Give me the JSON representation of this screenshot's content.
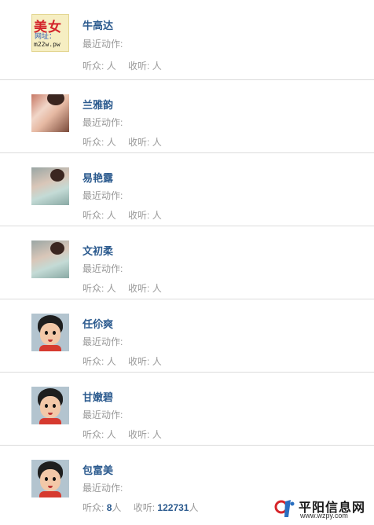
{
  "labels": {
    "recent_action": "最近动作:",
    "listeners_prefix": "听众:",
    "following_prefix": "收听:",
    "unit": "人"
  },
  "users": [
    {
      "name": "牛高达",
      "avatar": "ad",
      "listeners": "",
      "following": ""
    },
    {
      "name": "兰雅韵",
      "avatar": "photo1",
      "listeners": "",
      "following": ""
    },
    {
      "name": "易艳露",
      "avatar": "photo2",
      "listeners": "",
      "following": ""
    },
    {
      "name": "文初柔",
      "avatar": "photo2",
      "listeners": "",
      "following": ""
    },
    {
      "name": "任伱爽",
      "avatar": "cartoon",
      "listeners": "",
      "following": ""
    },
    {
      "name": "甘嫩碧",
      "avatar": "cartoon",
      "listeners": "",
      "following": ""
    },
    {
      "name": "包富美",
      "avatar": "cartoon",
      "listeners": "8",
      "following": "122731"
    }
  ],
  "ad_avatar": {
    "line1": "美女",
    "line2": "网址：",
    "line3": "m22w.pw"
  },
  "watermark": {
    "title": "平阳信息网",
    "url": "www.wzpy.com"
  },
  "colors": {
    "name_link": "#2b5a8e",
    "muted_text": "#999999",
    "divider": "#dcdcdc"
  }
}
